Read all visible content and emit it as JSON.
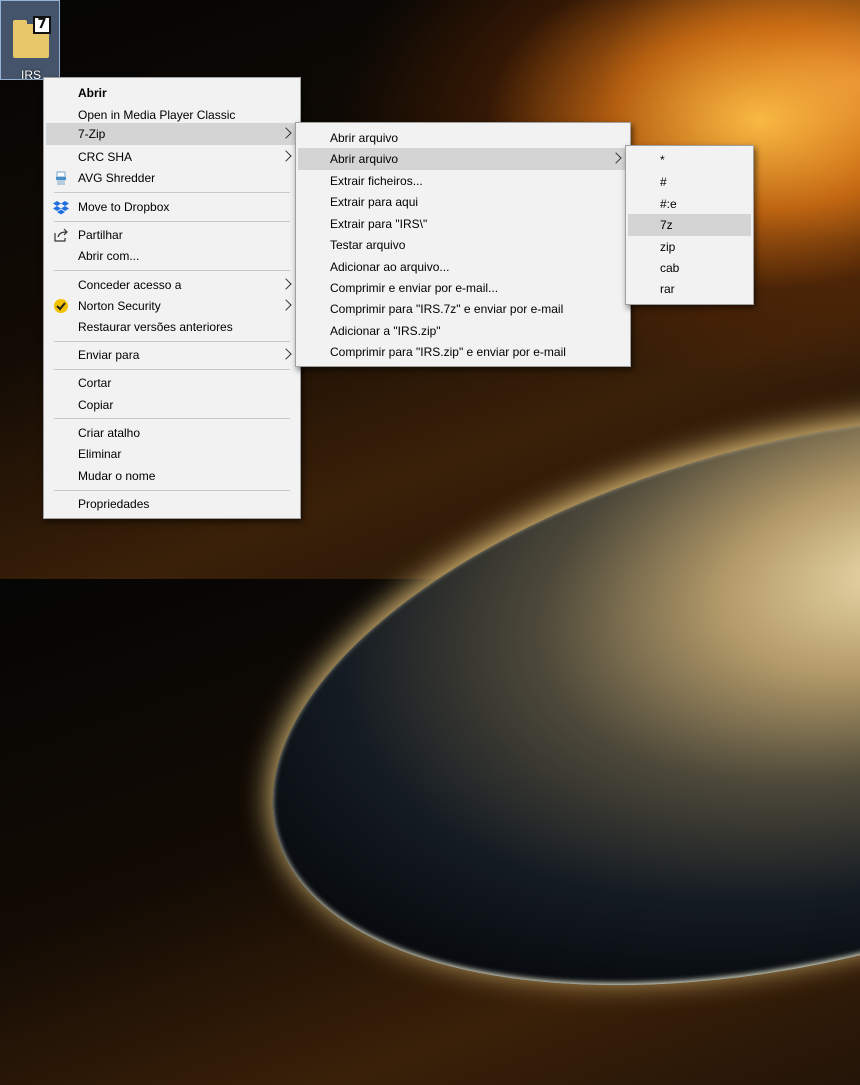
{
  "desktop": {
    "icon_label": "IRS",
    "icon_badge": "7"
  },
  "context_menu": {
    "items": [
      {
        "label": "Abrir"
      },
      {
        "label": "Open in Media Player Classic"
      },
      {
        "label": "7-Zip"
      },
      {
        "label": "CRC SHA"
      },
      {
        "label": "AVG Shredder"
      },
      {
        "label": "Move to Dropbox"
      },
      {
        "label": "Partilhar"
      },
      {
        "label": "Abrir com..."
      },
      {
        "label": "Conceder acesso a"
      },
      {
        "label": "Norton Security"
      },
      {
        "label": "Restaurar versões anteriores"
      },
      {
        "label": "Enviar para"
      },
      {
        "label": "Cortar"
      },
      {
        "label": "Copiar"
      },
      {
        "label": "Criar atalho"
      },
      {
        "label": "Eliminar"
      },
      {
        "label": "Mudar o nome"
      },
      {
        "label": "Propriedades"
      }
    ]
  },
  "zip_submenu": {
    "items": [
      {
        "label": "Abrir arquivo"
      },
      {
        "label": "Abrir arquivo"
      },
      {
        "label": "Extrair ficheiros..."
      },
      {
        "label": "Extrair para aqui"
      },
      {
        "label": "Extrair para \"IRS\\\""
      },
      {
        "label": "Testar arquivo"
      },
      {
        "label": "Adicionar ao arquivo..."
      },
      {
        "label": "Comprimir e enviar por e-mail..."
      },
      {
        "label": "Comprimir para \"IRS.7z\" e enviar por e-mail"
      },
      {
        "label": "Adicionar a \"IRS.zip\""
      },
      {
        "label": "Comprimir para \"IRS.zip\" e enviar por e-mail"
      }
    ]
  },
  "archive_type_submenu": {
    "items": [
      {
        "label": "*"
      },
      {
        "label": "#"
      },
      {
        "label": "#:e"
      },
      {
        "label": "7z"
      },
      {
        "label": "zip"
      },
      {
        "label": "cab"
      },
      {
        "label": "rar"
      }
    ]
  },
  "icons": {
    "avg_shredder": "shredder-icon",
    "dropbox": "dropbox-icon",
    "share": "share-icon",
    "norton": "norton-check-icon"
  },
  "colors": {
    "menu_bg": "#f2f2f2",
    "highlight": "#d4d4d4",
    "dropbox_blue": "#1f6fe0",
    "norton_yellow": "#f2c200"
  }
}
